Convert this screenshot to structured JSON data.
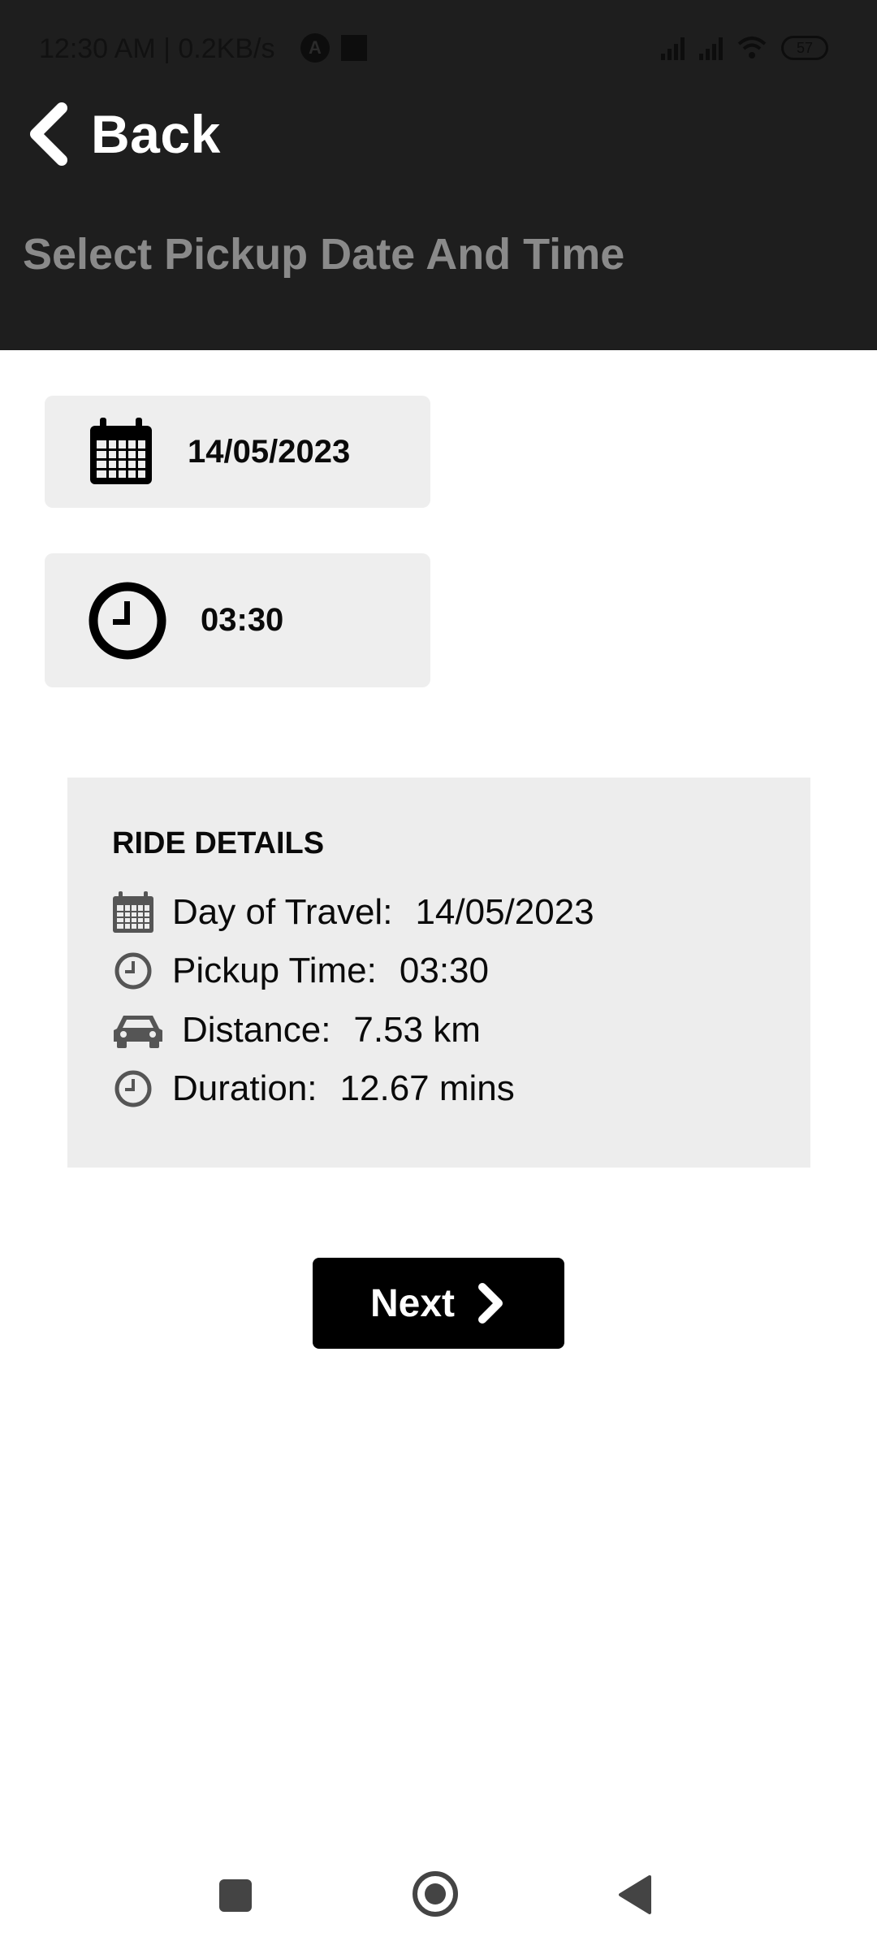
{
  "status_bar": {
    "time": "12:30 AM | 0.2KB/s",
    "battery": "57",
    "icons": [
      "app-a-icon",
      "upload-icon",
      "signal-icon",
      "signal-icon",
      "wifi-icon",
      "battery-icon"
    ]
  },
  "header": {
    "back_label": "Back",
    "title": "Select Pickup Date And Time"
  },
  "pickers": {
    "date_value": "14/05/2023",
    "time_value": "03:30"
  },
  "ride_details": {
    "title": "RIDE DETAILS",
    "rows": [
      {
        "icon": "calendar-icon",
        "label": "Day of Travel:",
        "value": "14/05/2023"
      },
      {
        "icon": "clock-icon",
        "label": "Pickup Time:",
        "value": "03:30"
      },
      {
        "icon": "car-icon",
        "label": "Distance:",
        "value": "7.53 km"
      },
      {
        "icon": "clock-icon",
        "label": "Duration:",
        "value": "12.67 mins"
      }
    ]
  },
  "next_button": {
    "label": "Next"
  },
  "colors": {
    "header_bg": "#1e1e1e",
    "title_gray": "#8a8a8a",
    "card_bg": "#eeeeee",
    "button_bg": "#000000"
  }
}
